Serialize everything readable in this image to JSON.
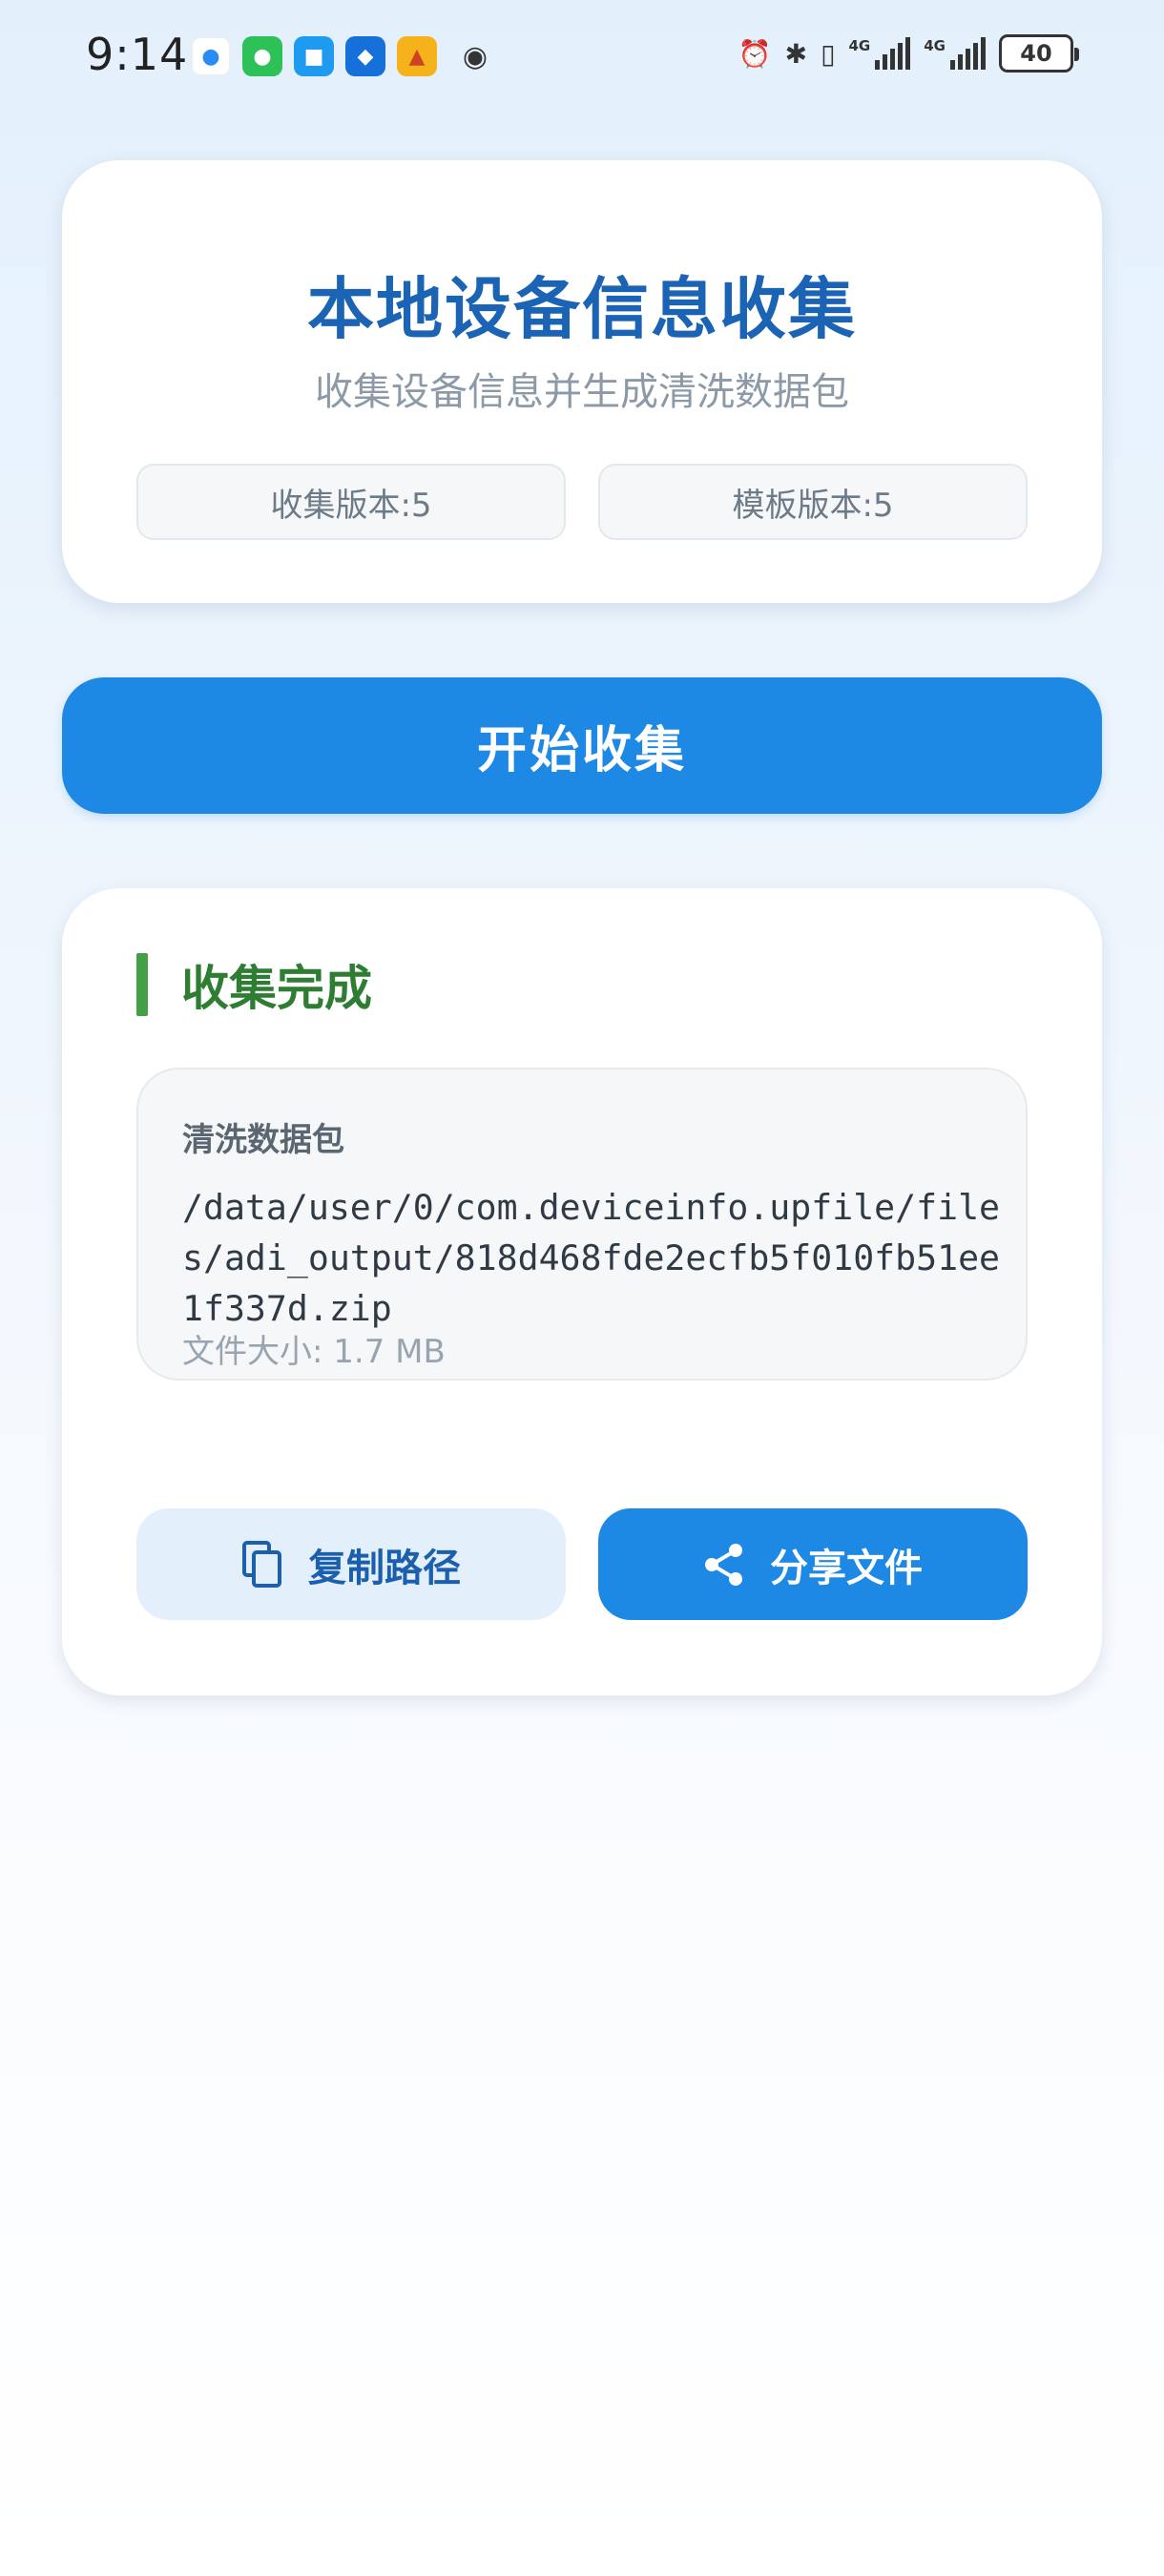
{
  "status_bar": {
    "time": "9:14",
    "battery": "40",
    "network": "4G",
    "notification_icons": [
      "bubble-app-icon",
      "wechat-icon",
      "messages-icon",
      "app-store-icon",
      "game-icon",
      "eye-icon"
    ]
  },
  "header": {
    "title": "本地设备信息收集",
    "subtitle": "收集设备信息并生成清洗数据包",
    "collect_version": "收集版本:5",
    "template_version": "模板版本:5"
  },
  "start_button": {
    "label": "开始收集"
  },
  "result": {
    "status_title": "收集完成",
    "package_label": "清洗数据包",
    "package_path": "/data/user/0/com.deviceinfo.upfile/files/adi_output/818d468fde2ecfb5f010fb51ee1f337d.zip",
    "file_size": "文件大小: 1.7 MB",
    "copy_label": "复制路径",
    "share_label": "分享文件"
  },
  "colors": {
    "title_blue": "#1b63b5",
    "primary_button": "#1e88e5",
    "success_green": "#2e7d32",
    "success_bar": "#43a047",
    "secondary_button_bg": "#e3f0fc"
  }
}
